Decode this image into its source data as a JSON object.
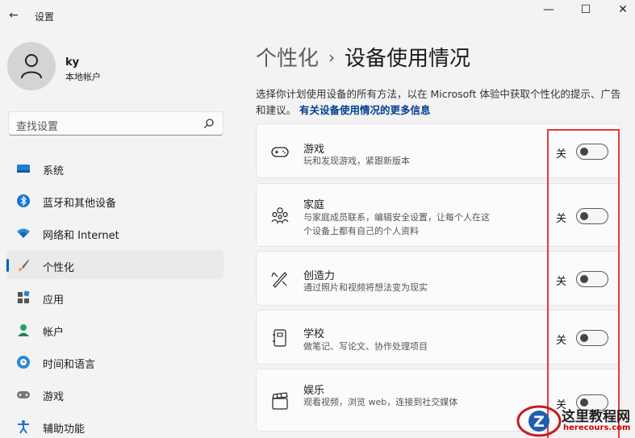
{
  "window": {
    "title": "设置",
    "back_glyph": "←",
    "minimize_glyph": "—",
    "maximize_glyph": "☐",
    "close_glyph": "✕"
  },
  "user": {
    "name": "ky",
    "account_type": "本地帐户"
  },
  "search": {
    "placeholder": "查找设置"
  },
  "sidebar": {
    "items": [
      {
        "label": "系统",
        "icon": "monitor-icon"
      },
      {
        "label": "蓝牙和其他设备",
        "icon": "bluetooth-icon"
      },
      {
        "label": "网络和 Internet",
        "icon": "wifi-icon"
      },
      {
        "label": "个性化",
        "icon": "brush-icon",
        "active": true
      },
      {
        "label": "应用",
        "icon": "apps-icon"
      },
      {
        "label": "帐户",
        "icon": "account-icon"
      },
      {
        "label": "时间和语言",
        "icon": "globe-clock-icon"
      },
      {
        "label": "游戏",
        "icon": "gamepad-icon"
      },
      {
        "label": "辅助功能",
        "icon": "accessibility-icon"
      }
    ]
  },
  "breadcrumb": {
    "parent": "个性化",
    "separator": "›",
    "current": "设备使用情况"
  },
  "description": {
    "text": "选择你计划使用设备的所有方法，以在 Microsoft 体验中获取个性化的提示、广告和建议。",
    "link": "有关设备使用情况的更多信息"
  },
  "cards": [
    {
      "title": "游戏",
      "desc": "玩和发现游戏，紧跟新版本",
      "state": "关",
      "icon": "gamepad-icon",
      "on": false
    },
    {
      "title": "家庭",
      "desc": "与家庭成员联系，编辑安全设置，让每个人在这个设备上都有自己的个人资料",
      "state": "关",
      "icon": "family-icon",
      "on": false
    },
    {
      "title": "创造力",
      "desc": "通过照片和视频将想法变为现实",
      "state": "关",
      "icon": "creativity-icon",
      "on": false
    },
    {
      "title": "学校",
      "desc": "做笔记、写论文、协作处理项目",
      "state": "关",
      "icon": "notebook-icon",
      "on": false
    },
    {
      "title": "娱乐",
      "desc": "观看视频，浏览 web，连接到社交媒体",
      "state": "关",
      "icon": "clapperboard-icon",
      "on": false
    }
  ],
  "watermark": {
    "title": "这里教程网",
    "url": "herecours.com"
  },
  "colors": {
    "accent": "#005fb8",
    "highlight": "#e53a3a",
    "link": "#003e92"
  }
}
